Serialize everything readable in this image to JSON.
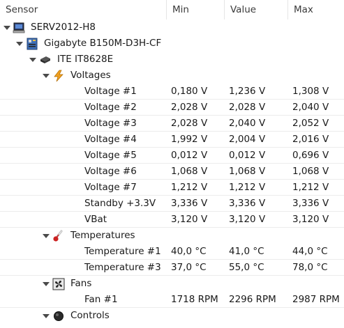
{
  "columns": {
    "sensor": "Sensor",
    "min": "Min",
    "value": "Value",
    "max": "Max"
  },
  "tree": {
    "computer": {
      "label": "SERV2012-H8",
      "icon": "computer-icon"
    },
    "motherboard": {
      "label": "Gigabyte B150M-D3H-CF",
      "icon": "motherboard-icon"
    },
    "chip": {
      "label": "ITE IT8628E",
      "icon": "chip-icon"
    },
    "voltages": {
      "label": "Voltages",
      "icon": "lightning-icon",
      "items": [
        {
          "name": "Voltage #1",
          "min": "0,180 V",
          "value": "1,236 V",
          "max": "1,308 V"
        },
        {
          "name": "Voltage #2",
          "min": "2,028 V",
          "value": "2,028 V",
          "max": "2,040 V"
        },
        {
          "name": "Voltage #3",
          "min": "2,028 V",
          "value": "2,040 V",
          "max": "2,052 V"
        },
        {
          "name": "Voltage #4",
          "min": "1,992 V",
          "value": "2,004 V",
          "max": "2,016 V"
        },
        {
          "name": "Voltage #5",
          "min": "0,012 V",
          "value": "0,012 V",
          "max": "0,696 V"
        },
        {
          "name": "Voltage #6",
          "min": "1,068 V",
          "value": "1,068 V",
          "max": "1,068 V"
        },
        {
          "name": "Voltage #7",
          "min": "1,212 V",
          "value": "1,212 V",
          "max": "1,212 V"
        },
        {
          "name": "Standby +3.3V",
          "min": "3,336 V",
          "value": "3,336 V",
          "max": "3,336 V"
        },
        {
          "name": "VBat",
          "min": "3,120 V",
          "value": "3,120 V",
          "max": "3,120 V"
        }
      ]
    },
    "temperatures": {
      "label": "Temperatures",
      "icon": "thermometer-icon",
      "items": [
        {
          "name": "Temperature #1",
          "min": "40,0 °C",
          "value": "41,0 °C",
          "max": "44,0 °C"
        },
        {
          "name": "Temperature #3",
          "min": "37,0 °C",
          "value": "55,0 °C",
          "max": "78,0 °C"
        }
      ]
    },
    "fans": {
      "label": "Fans",
      "icon": "fan-icon",
      "items": [
        {
          "name": "Fan #1",
          "min": "1718 RPM",
          "value": "2296 RPM",
          "max": "2987 RPM"
        }
      ]
    },
    "controls": {
      "label": "Controls",
      "icon": "control-knob-icon"
    }
  },
  "colors": {
    "thermometer_bulb": "#cc2222",
    "lightning": "#f0a020",
    "grid_line": "#ececec"
  }
}
